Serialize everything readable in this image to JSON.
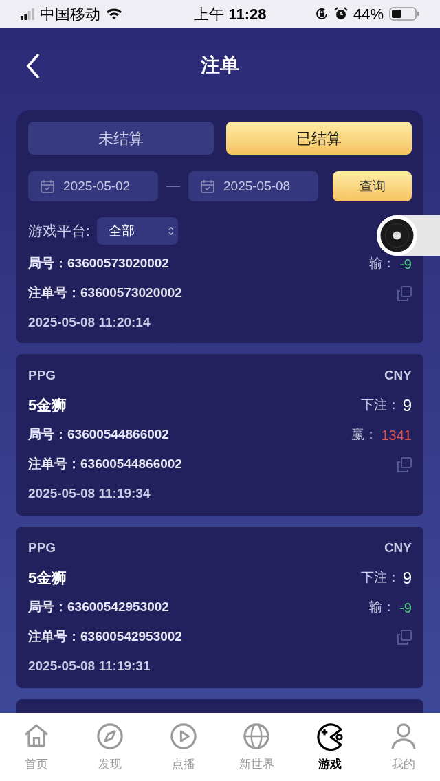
{
  "status_bar": {
    "carrier": "中国移动",
    "time": "上午 **11:28**",
    "battery": "44%"
  },
  "nav": {
    "title": "注单"
  },
  "filter": {
    "tabs": [
      {
        "label": "未结算",
        "selected": false
      },
      {
        "label": "已结算",
        "selected": true
      }
    ],
    "start_date": "2025-05-02",
    "end_date": "2025-05-08",
    "query_button": "查询",
    "platform_label": "游戏平台:",
    "platform_value": "全部"
  },
  "orders": [
    {
      "round": "局号：63600573020002",
      "result": {
        "kind": "lose",
        "label": "输：",
        "amount": "-9"
      },
      "order_no": "注单号：63600573020002",
      "time": "2025-05-08 11:20:14"
    },
    {
      "platform": "PPG",
      "currency": "CNY",
      "game": "5金狮",
      "bet_label": "下注：",
      "bet": "9",
      "round": "局号：63600544866002",
      "result": {
        "kind": "win",
        "label": "赢：",
        "amount": "1341"
      },
      "order_no": "注单号：63600544866002",
      "time": "2025-05-08 11:19:34"
    },
    {
      "platform": "PPG",
      "currency": "CNY",
      "game": "5金狮",
      "bet_label": "下注：",
      "bet": "9",
      "round": "局号：63600542953002",
      "result": {
        "kind": "lose",
        "label": "输：",
        "amount": "-9"
      },
      "order_no": "注单号：63600542953002",
      "time": "2025-05-08 11:19:31"
    }
  ],
  "tab_bar": [
    {
      "label": "首页",
      "selected": false
    },
    {
      "label": "发现",
      "selected": false
    },
    {
      "label": "点播",
      "selected": false
    },
    {
      "label": "新世界",
      "selected": false
    },
    {
      "label": "游戏",
      "selected": true
    },
    {
      "label": "我的",
      "selected": false
    }
  ]
}
